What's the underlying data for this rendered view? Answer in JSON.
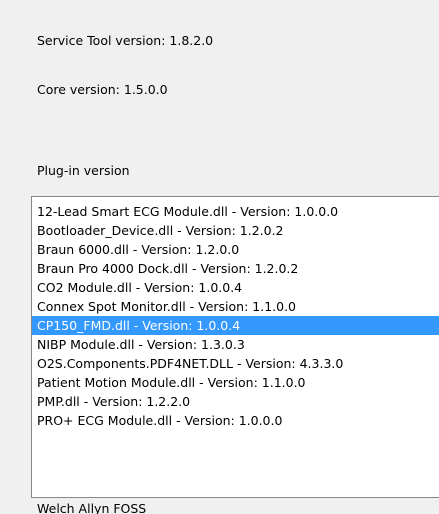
{
  "service_tool": {
    "label": "Service Tool version: 1.8.2.0"
  },
  "core": {
    "label": "Core version: 1.5.0.0"
  },
  "plugins": {
    "heading": "Plug-in version",
    "items": [
      {
        "label": "12-Lead Smart ECG Module.dll - Version: 1.0.0.0"
      },
      {
        "label": "Bootloader_Device.dll - Version: 1.2.0.2"
      },
      {
        "label": "Braun 6000.dll - Version: 1.2.0.0"
      },
      {
        "label": "Braun Pro 4000 Dock.dll - Version: 1.2.0.2"
      },
      {
        "label": "CO2 Module.dll - Version: 1.0.0.4"
      },
      {
        "label": "Connex Spot Monitor.dll - Version: 1.1.0.0"
      },
      {
        "label": "CP150_FMD.dll - Version: 1.0.0.4",
        "selected": true
      },
      {
        "label": "NIBP Module.dll - Version: 1.3.0.3"
      },
      {
        "label": "O2S.Components.PDF4NET.DLL - Version: 4.3.3.0"
      },
      {
        "label": "Patient Motion Module.dll - Version: 1.1.0.0"
      },
      {
        "label": "PMP.dll - Version: 1.2.2.0"
      },
      {
        "label": "PRO+ ECG Module.dll - Version: 1.0.0.0"
      }
    ],
    "selection_color": "#3399ff"
  },
  "footer": {
    "label": "Welch Allyn FOSS"
  }
}
